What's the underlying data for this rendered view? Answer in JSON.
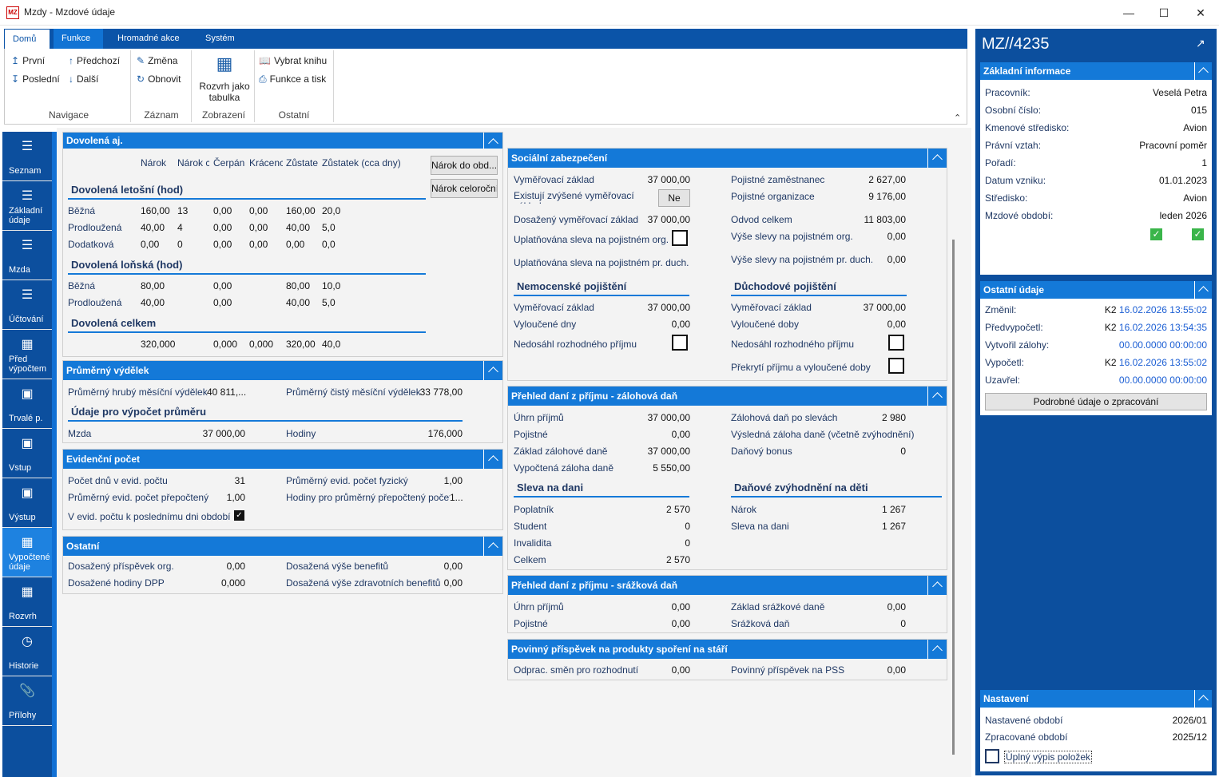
{
  "window": {
    "title": "Mzdy - Mzdové údaje",
    "icon": "MZ"
  },
  "ribbon": {
    "tabs": [
      "Domů",
      "Funkce",
      "Hromadné akce",
      "Systém"
    ],
    "nav": {
      "first": "První",
      "prev": "Předchozí",
      "last": "Poslední",
      "next": "Další",
      "group": "Navigace"
    },
    "record": {
      "change": "Změna",
      "refresh": "Obnovit",
      "group": "Záznam"
    },
    "view": {
      "layout_line1": "Rozvrh jako",
      "layout_line2": "tabulka",
      "group": "Zobrazení"
    },
    "other": {
      "book": "Vybrat knihu",
      "print": "Funkce a tisk",
      "group": "Ostatní"
    }
  },
  "leftnav": [
    {
      "label": "Seznam",
      "icon": "list-icon"
    },
    {
      "label": "Základní údaje",
      "icon": "list-icon"
    },
    {
      "label": "Mzda",
      "icon": "list-icon"
    },
    {
      "label": "Účtování",
      "icon": "list-icon"
    },
    {
      "label": "Před výpočtem",
      "icon": "calculator-icon"
    },
    {
      "label": "Trvalé p.",
      "icon": "box-icon"
    },
    {
      "label": "Vstup",
      "icon": "box-icon"
    },
    {
      "label": "Výstup",
      "icon": "box-icon"
    },
    {
      "label": "Vypočtené údaje",
      "icon": "calculator-icon"
    },
    {
      "label": "Rozvrh",
      "icon": "calendar-icon"
    },
    {
      "label": "Historie",
      "icon": "clock-icon"
    },
    {
      "label": "Přílohy",
      "icon": "paperclip-icon"
    }
  ],
  "vacation": {
    "title": "Dovolená aj.",
    "headers": [
      "Nárok",
      "Nárok c",
      "Čerpán",
      "Krácenc",
      "Zůstate",
      "Zůstatek (cca dny)"
    ],
    "btn1": "Nárok do obd...",
    "btn2": "Nárok celoroční",
    "current": {
      "title": "Dovolená letošní (hod)",
      "rows": [
        {
          "label": "Běžná",
          "vals": [
            "160,00",
            "13",
            "0,00",
            "0,00",
            "160,00",
            "20,0"
          ]
        },
        {
          "label": "Prodloužená",
          "vals": [
            "40,00",
            "4",
            "0,00",
            "0,00",
            "40,00",
            "5,0"
          ]
        },
        {
          "label": "Dodatková",
          "vals": [
            "0,00",
            "0",
            "0,00",
            "0,00",
            "0,00",
            "0,0"
          ]
        }
      ]
    },
    "last": {
      "title": "Dovolená loňská (hod)",
      "rows": [
        {
          "label": "Běžná",
          "vals": [
            "80,00",
            "",
            "0,00",
            "",
            "80,00",
            "10,0"
          ]
        },
        {
          "label": "Prodloužená",
          "vals": [
            "40,00",
            "",
            "0,00",
            "",
            "40,00",
            "5,0"
          ]
        }
      ]
    },
    "total": {
      "title": "Dovolená celkem",
      "vals": [
        "320,000",
        "",
        "0,000",
        "0,000",
        "320,00",
        "40,0"
      ]
    }
  },
  "avg": {
    "title": "Průměrný výdělek",
    "gross_label": "Průměrný hrubý měsíční výdělek",
    "gross": "40 811,...",
    "net_label": "Průměrný čistý měsíční výdělek",
    "net": "33 778,00",
    "sub": "Údaje pro výpočet průměru",
    "wage_label": "Mzda",
    "wage": "37 000,00",
    "hours_label": "Hodiny",
    "hours": "176,000"
  },
  "evid": {
    "title": "Evidenční počet",
    "days_label": "Počet dnů v evid. počtu",
    "days": "31",
    "phys_label": "Průměrný evid. počet fyzický",
    "phys": "1,00",
    "recalc_label": "Průměrný evid. počet přepočtený",
    "recalc": "1,00",
    "hours_label": "Hodiny pro průměrný přepočtený počet",
    "hours": "1...",
    "last_day_label": "V evid. počtu k poslednímu dni období"
  },
  "other": {
    "title": "Ostatní",
    "contrib_label": "Dosažený příspěvek org.",
    "contrib": "0,00",
    "benefits_label": "Dosažená výše benefitů",
    "benefits": "0,00",
    "dpp_label": "Dosažené hodiny DPP",
    "dpp": "0,000",
    "health_label": "Dosažená výše zdravotních benefitů",
    "health": "0,00"
  },
  "social": {
    "title": "Sociální zabezpečení",
    "base_label": "Vyměřovací základ",
    "base": "37 000,00",
    "emp_label": "Pojistné zaměstnanec",
    "emp": "2 627,00",
    "increased_label": "Existují zvýšené vyměřovací základy",
    "increased": "Ne",
    "org_label": "Pojistné organizace",
    "org": "9 176,00",
    "reached_label": "Dosažený vyměřovací základ",
    "reached": "37 000,00",
    "total_label": "Odvod celkem",
    "total": "11 803,00",
    "disc_org_label": "Uplatňována sleva na pojistném org.",
    "disc_org_amt_label": "Výše slevy na pojistném org.",
    "disc_org_amt": "0,00",
    "disc_pd_label": "Uplatňována sleva na pojistném pr. duch.",
    "disc_pd_amt_label": "Výše slevy na pojistném pr. duch.",
    "disc_pd_amt": "0,00",
    "sick_title": "Nemocenské pojištění",
    "pension_title": "Důchodové pojištění",
    "sick_base_label": "Vyměřovací základ",
    "sick_base": "37 000,00",
    "pen_base_label": "Vyměřovací základ",
    "pen_base": "37 000,00",
    "excl_days_label": "Vyloučené dny",
    "excl_days": "0,00",
    "excl_per_label": "Vyloučené doby",
    "excl_per": "0,00",
    "not_reached_label": "Nedosáhl rozhodného příjmu",
    "not_reached2_label": "Nedosáhl rozhodného příjmu",
    "overlap_label": "Překrytí příjmu a vyloučené doby"
  },
  "tax": {
    "title": "Přehled daní z příjmu - zálohová daň",
    "income_label": "Úhrn příjmů",
    "income": "37 000,00",
    "after_disc_label": "Zálohová daň po slevách",
    "after_disc": "2 980",
    "ins_label": "Pojistné",
    "ins": "0,00",
    "result_label": "Výsledná záloha daně (včetně zvýhodnění)",
    "base_label": "Základ zálohové daně",
    "base": "37 000,00",
    "bonus_label": "Daňový bonus",
    "bonus": "0",
    "calc_label": "Vypočtená záloha daně",
    "calc": "5 550,00",
    "disc_title": "Sleva na dani",
    "child_title": "Daňové zvýhodnění na děti",
    "payer_label": "Poplatník",
    "payer": "2 570",
    "claim_label": "Nárok",
    "claim": "1 267",
    "student_label": "Student",
    "student": "0",
    "tdisc_label": "Sleva na dani",
    "tdisc": "1 267",
    "inv_label": "Invalidita",
    "inv": "0",
    "sum_label": "Celkem",
    "sum": "2 570"
  },
  "wtax": {
    "title": "Přehled daní z příjmu - srážková daň",
    "income_label": "Úhrn příjmů",
    "income": "0,00",
    "base_label": "Základ srážkové daně",
    "base": "0,00",
    "ins_label": "Pojistné",
    "ins": "0,00",
    "tax_label": "Srážková daň",
    "tax": "0"
  },
  "pss": {
    "title": "Povinný příspěvek na produkty spoření na stáří",
    "shifts_label": "Odprac. směn pro rozhodnutí",
    "shifts": "0,00",
    "contrib_label": "Povinný příspěvek na PSS",
    "contrib": "0,00"
  },
  "record_id": "MZ//4235",
  "basic": {
    "title": "Základní informace",
    "rows": [
      {
        "label": "Pracovník:",
        "value": "Veselá Petra"
      },
      {
        "label": "Osobní číslo:",
        "value": "015"
      },
      {
        "label": "Kmenové středisko:",
        "value": "Avion"
      },
      {
        "label": "Právní vztah:",
        "value": "Pracovní poměr"
      },
      {
        "label": "Pořadí:",
        "value": "1"
      },
      {
        "label": "Datum vzniku:",
        "value": "01.01.2023"
      },
      {
        "label": "Středisko:",
        "value": "Avion"
      },
      {
        "label": "Mzdové období:",
        "value": "leden 2026"
      }
    ]
  },
  "otherinfo": {
    "title": "Ostatní údaje",
    "rows": [
      {
        "label": "Změnil:",
        "user": "K2",
        "date": "16.02.2026 13:55:02"
      },
      {
        "label": "Předvypočetl:",
        "user": "K2",
        "date": "16.02.2026 13:54:35"
      },
      {
        "label": "Vytvořil zálohy:",
        "user": "",
        "date": "00.00.0000 00:00:00"
      },
      {
        "label": "Vypočetl:",
        "user": "K2",
        "date": "16.02.2026 13:55:02"
      },
      {
        "label": "Uzavřel:",
        "user": "",
        "date": "00.00.0000 00:00:00"
      }
    ],
    "btn": "Podrobné údaje o zpracování"
  },
  "settings": {
    "title": "Nastavení",
    "period_label": "Nastavené období",
    "period": "2026/01",
    "processed_label": "Zpracované období",
    "processed": "2025/12",
    "full_label": "Úplný výpis položek"
  },
  "colors": {
    "accent": "#1479d8",
    "nav": "#0c4f9e",
    "check": "#3ab54a"
  }
}
